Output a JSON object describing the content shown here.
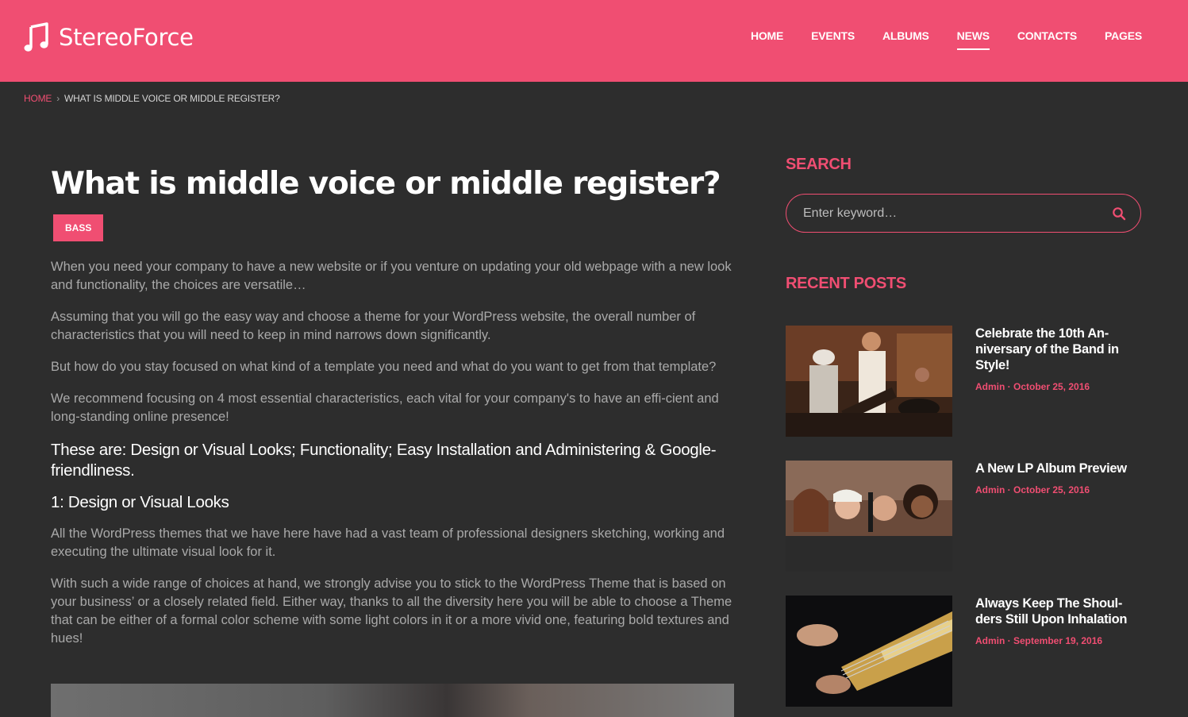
{
  "brand": {
    "name": "StereoForce",
    "accent": "#f04e72"
  },
  "nav": {
    "items": [
      "HOME",
      "EVENTS",
      "ALBUMS",
      "NEWS",
      "CONTACTS",
      "PAGES"
    ],
    "active": "NEWS"
  },
  "breadcrumb": {
    "home": "HOME",
    "separator": "›",
    "current": "WHAT IS MIDDLE VOICE OR MIDDLE REGISTER?"
  },
  "article": {
    "title": "What is middle voice or middle register?",
    "tag": "BASS",
    "p1": "When you need your company to have a new website or if you venture on updating your old webpage with a new look and functionality, the choices are versatile…",
    "p2": "Assuming that you will go the easy way and choose a theme for your WordPress website, the overall number of characteristics that you will need to keep in mind narrows down significantly.",
    "p3": "But how do you stay focused on what kind of a template you need and what do you want to get from that template?",
    "p4": "We recommend focusing on 4 most essential characteristics, each vital for your company's to have an effi-cient and long-standing online presence!",
    "strong": "These are: Design or Visual Looks; Functionality; Easy Installation and Administering & Google-friendliness.",
    "subheading": "1: Design or Visual Looks",
    "p5": "All the WordPress themes that we have here have had a vast team of professional designers sketching, working and executing the ultimate visual look for it.",
    "p6": "With such a wide range of choices at hand, we strongly advise you to stick to the WordPress Theme that is based on your business’ or a closely related field. Either way, thanks to all the diversity here you will be able to choose a Theme that can be either of a formal color scheme with some light colors in it or a more vivid one, featuring bold textures and hues!"
  },
  "sidebar": {
    "search_title": "SEARCH",
    "search_placeholder": "Enter keyword…",
    "recent_title": "RECENT POSTS",
    "posts": [
      {
        "title": "Celebrate the 10th An-niversary of the Band in Style!",
        "meta": "Admin · October 25, 2016"
      },
      {
        "title": "A New LP Album Preview",
        "meta": "Admin · October 25, 2016"
      },
      {
        "title": "Always Keep The Shoul-ders Still Upon Inhalation",
        "meta": "Admin · September 19, 2016"
      }
    ]
  }
}
